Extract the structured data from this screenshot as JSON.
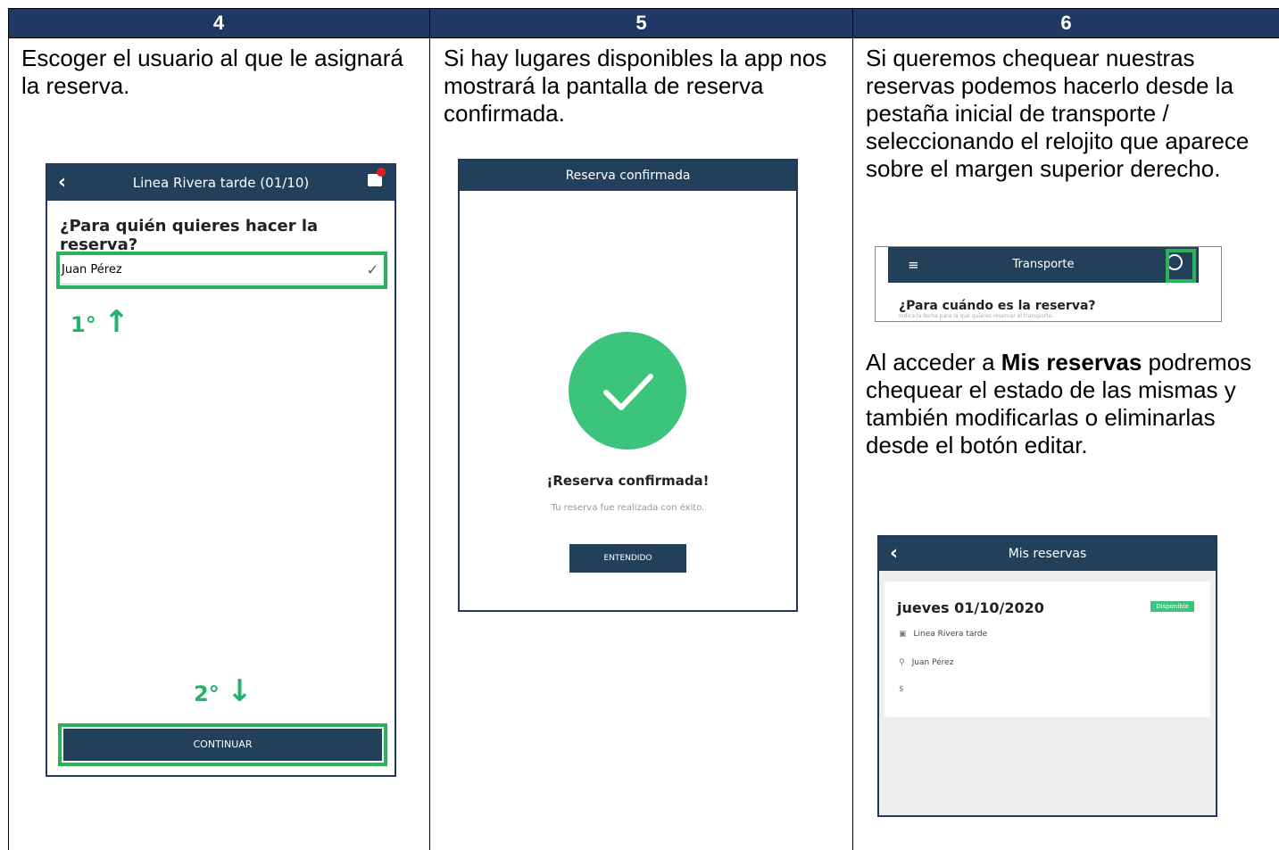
{
  "headers": [
    "4",
    "5",
    "6"
  ],
  "col4": {
    "description": "Escoger el usuario al que le asignará la reserva.",
    "phone": {
      "title": "Linea Rivera tarde (01/10)",
      "question": "¿Para quién quieres hacer la reserva?",
      "selected_user": "Juan Pérez",
      "step1": "1°",
      "step2": "2°",
      "continue_label": "CONTINUAR"
    }
  },
  "col5": {
    "description": "Si hay lugares disponibles la app nos mostrará la pantalla de reserva confirmada.",
    "phone": {
      "title": "Reserva confirmada",
      "heading": "¡Reserva confirmada!",
      "message": "Tu reserva fue realizada con éxito.",
      "button": "ENTENDIDO"
    }
  },
  "col6": {
    "description": "Si queremos chequear nuestras reservas podemos hacerlo desde la pestaña inicial de transporte / seleccionando el relojito que aparece sobre el margen superior derecho.",
    "transport": {
      "title": "Transporte",
      "question": "¿Para cuándo es la reserva?",
      "hint": "Indica la fecha para la que quieres reservar el transporte."
    },
    "desc2_prefix": "Al acceder a ",
    "desc2_bold": "Mis reservas",
    "desc2_suffix": " podremos chequear el estado de las mismas y también modificarlas o eliminarlas desde el botón editar.",
    "mis_reservas": {
      "title": "Mis reservas",
      "date": "jueves 01/10/2020",
      "badge": "Disponible",
      "line": "Linea Rivera tarde",
      "user": "Juan Pérez",
      "price": "$"
    }
  },
  "colors": {
    "header_bg": "#1f3864",
    "appbar": "#22405a",
    "success": "#3cc47c",
    "highlight": "#2bb35a"
  }
}
